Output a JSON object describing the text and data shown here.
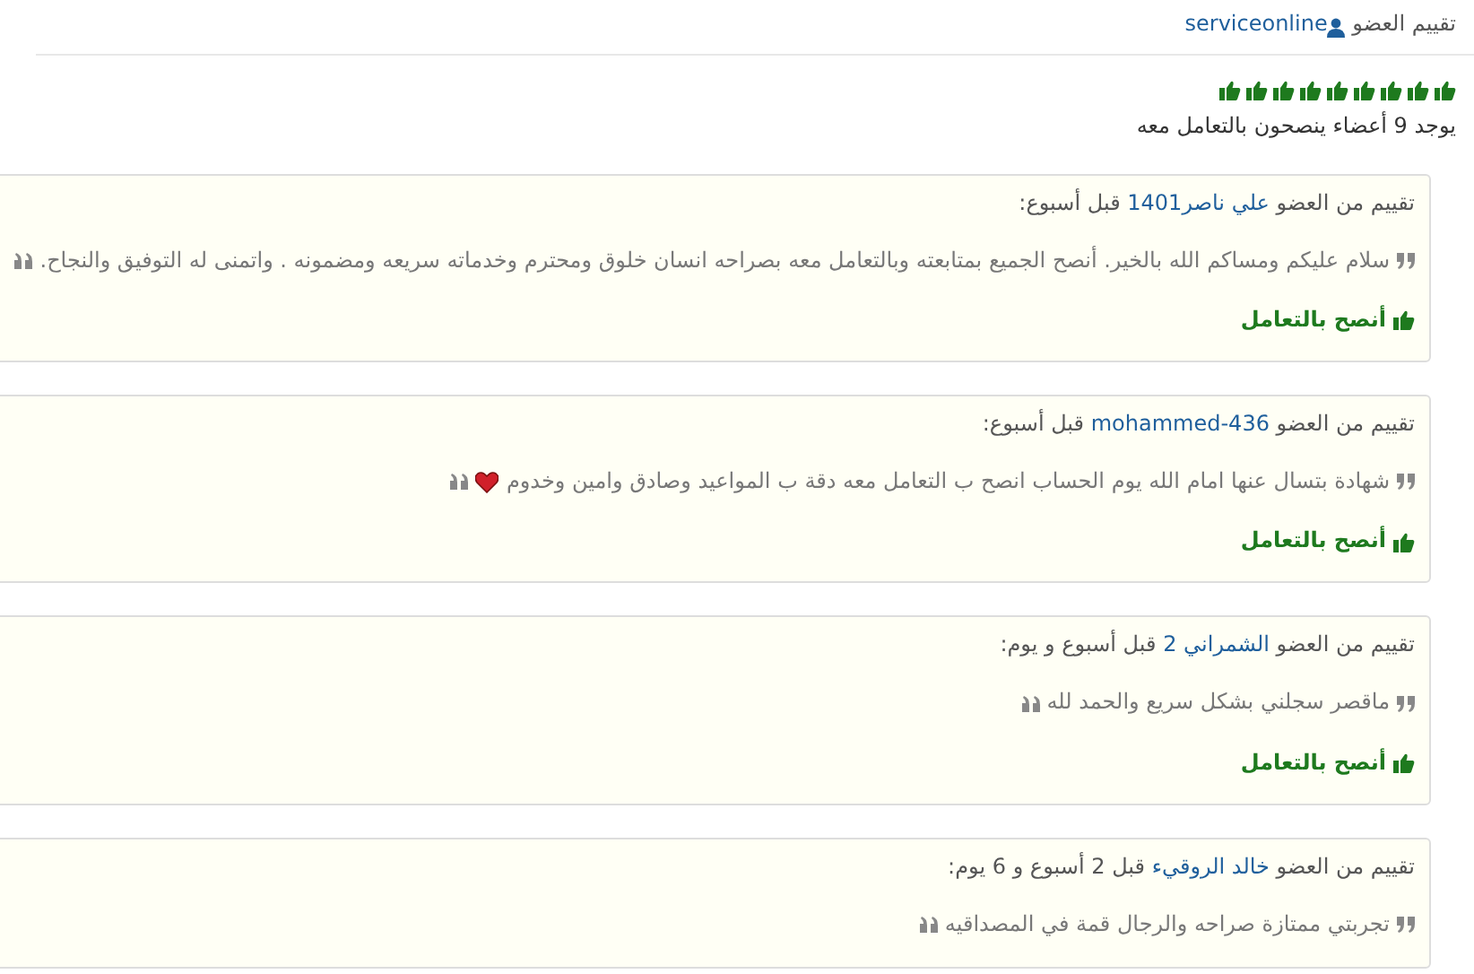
{
  "header": {
    "label": "تقييم العضو",
    "member": "serviceonline"
  },
  "thumbs": {
    "stars": 9
  },
  "summary": "يوجد 9 أعضاء ينصحون بالتعامل معه",
  "reviews": [
    {
      "prefix": "تقييم من العضو",
      "member": "علي ناصر1401",
      "time": "قبل أسبوع:",
      "text": "سلام عليكم ومساكم الله بالخير. أنصح الجميع بمتابعته وبالتعامل معه بصراحه انسان خلوق ومحترم وخدماته سريعه ومضمونه . واتمنى له التوفيق والنجاح.",
      "heart": false,
      "recommend": "أنصح بالتعامل"
    },
    {
      "prefix": "تقييم من العضو",
      "member": "mohammed-436",
      "time": "قبل أسبوع:",
      "text": "شهادة بتسال عنها امام الله يوم الحساب انصح ب التعامل معه دقة ب المواعيد وصادق وامين وخدوم",
      "heart": true,
      "recommend": "أنصح بالتعامل"
    },
    {
      "prefix": "تقييم من العضو",
      "member": "الشمراني 2",
      "time": "قبل أسبوع و يوم:",
      "text": "ماقصر سجلني بشكل سريع والحمد لله",
      "heart": false,
      "recommend": "أنصح بالتعامل"
    },
    {
      "prefix": "تقييم من العضو",
      "member": "خالد الروقيء",
      "time": "قبل 2 أسبوع و 6 يوم:",
      "text": "تجربتي ممتازة صراحه والرجال قمة في المصداقيه",
      "heart": false
    }
  ]
}
